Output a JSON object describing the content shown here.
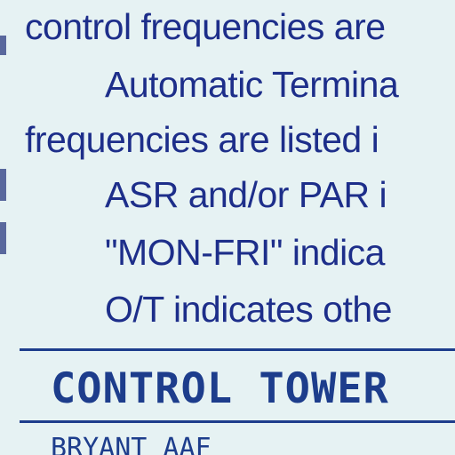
{
  "body_lines": [
    "control frequencies are",
    "Automatic Termina",
    "frequencies are listed i",
    "ASR and/or PAR i",
    "\"MON-FRI\" indica",
    "O/T indicates othe"
  ],
  "section_heading": "CONTROL TOWER",
  "entry_line": "BRYANT AAF",
  "colors": {
    "text": "#1d2e8a",
    "rule": "#1d3d8c",
    "paper": "#e6f2f3"
  }
}
